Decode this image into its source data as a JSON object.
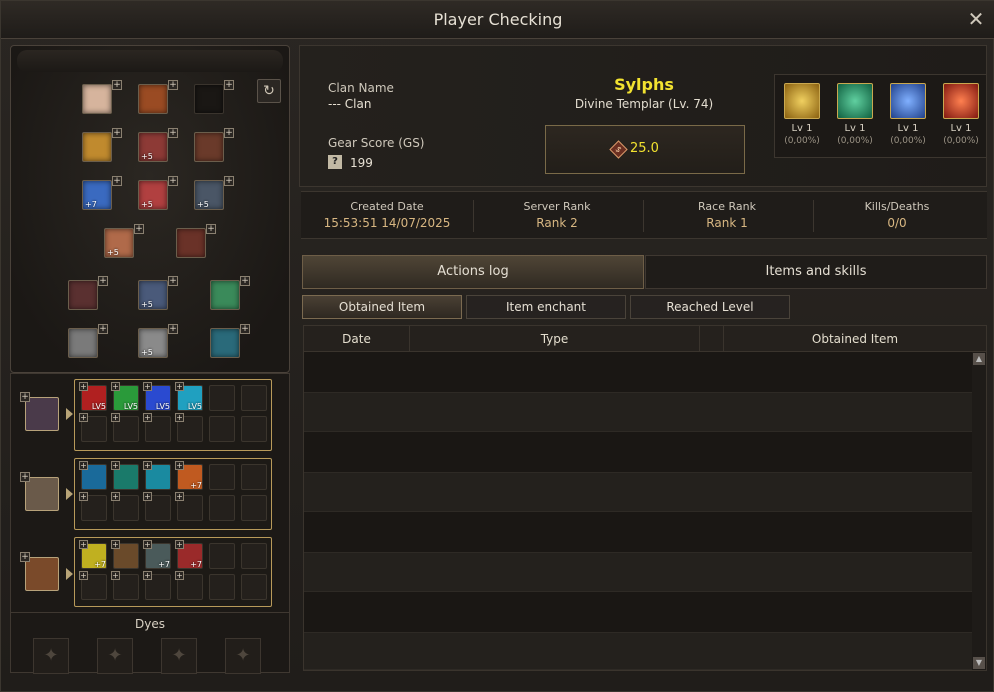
{
  "window": {
    "title": "Player Checking",
    "close_icon": "close-icon"
  },
  "player": {
    "clan_label": "Clan Name",
    "clan_value": "--- Clan",
    "gs_label": "Gear Score (GS)",
    "gs_icon": "?",
    "gs_value": "199",
    "name": "Sylphs",
    "class_line": "Divine Templar (Lv. 74)",
    "power_value": "25.0"
  },
  "skills": [
    {
      "lv": "Lv 1",
      "pct": "(0,00%)",
      "color": "#d9a820"
    },
    {
      "lv": "Lv 1",
      "pct": "(0,00%)",
      "color": "#2aa56e"
    },
    {
      "lv": "Lv 1",
      "pct": "(0,00%)",
      "color": "#3b6fd6"
    },
    {
      "lv": "Lv 1",
      "pct": "(0,00%)",
      "color": "#c83020"
    }
  ],
  "stats": [
    {
      "label": "Created Date",
      "value": "15:53:51 14/07/2025"
    },
    {
      "label": "Server Rank",
      "value": "Rank 2"
    },
    {
      "label": "Race Rank",
      "value": "Rank 1"
    },
    {
      "label": "Kills/Deaths",
      "value": "0/0"
    }
  ],
  "tabs": {
    "main": [
      "Actions log",
      "Items and skills"
    ],
    "sub": [
      "Obtained Item",
      "Item enchant",
      "Reached Level"
    ]
  },
  "table": {
    "columns": [
      "Date",
      "Type",
      "Obtained Item"
    ]
  },
  "equipment": {
    "enchant_labels": [
      "+5",
      "+7",
      "+5",
      "+5",
      "+5",
      "+5",
      "+5"
    ]
  },
  "gems": {
    "levels": [
      "LV5",
      "LV5",
      "LV5",
      "LV5"
    ],
    "enchants": [
      "+7",
      "+7",
      "+7",
      "+7"
    ]
  },
  "dyes_label": "Dyes",
  "refresh_icon": "↻",
  "plus_glyph": "+"
}
